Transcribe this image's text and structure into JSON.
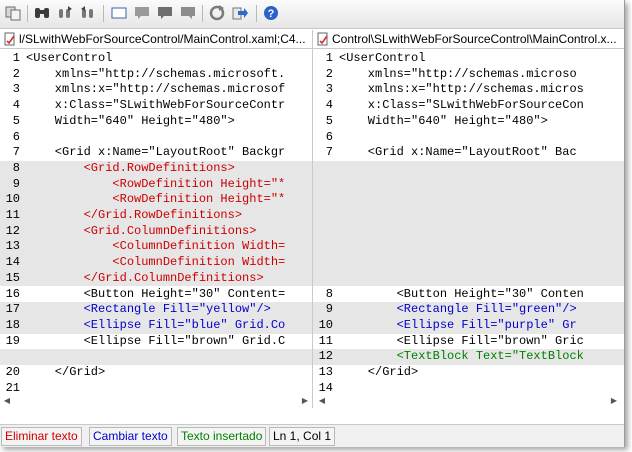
{
  "colors": {
    "deleted": "#cc0000",
    "changed": "#0000cc",
    "inserted": "#008000",
    "normal": "#000000"
  },
  "toolbar": {
    "icons": [
      "copy-icon",
      "binoculars-icon",
      "find-previous-icon",
      "find-next-icon",
      "rectangle-icon",
      "comment-icon",
      "comment-dark-icon",
      "comment-alt-icon",
      "refresh-icon",
      "export-arrow-icon",
      "help-icon"
    ]
  },
  "left": {
    "title": "l/SLwithWebForSourceControl/MainControl.xaml;C4...",
    "lines": [
      {
        "n": "1",
        "t": "<UserControl",
        "c": "normal",
        "g": false
      },
      {
        "n": "2",
        "t": "    xmlns=\"http://schemas.microsoft.",
        "c": "normal",
        "g": false
      },
      {
        "n": "3",
        "t": "    xmlns:x=\"http://schemas.microsof",
        "c": "normal",
        "g": false
      },
      {
        "n": "4",
        "t": "    x:Class=\"SLwithWebForSourceContr",
        "c": "normal",
        "g": false
      },
      {
        "n": "5",
        "t": "    Width=\"640\" Height=\"480\">",
        "c": "normal",
        "g": false
      },
      {
        "n": "6",
        "t": "",
        "c": "normal",
        "g": false
      },
      {
        "n": "7",
        "t": "    <Grid x:Name=\"LayoutRoot\" Backgr",
        "c": "normal",
        "g": false
      },
      {
        "n": "8",
        "t": "        <Grid.RowDefinitions>",
        "c": "deleted",
        "g": true
      },
      {
        "n": "9",
        "t": "            <RowDefinition Height=\"*",
        "c": "deleted",
        "g": true
      },
      {
        "n": "10",
        "t": "            <RowDefinition Height=\"*",
        "c": "deleted",
        "g": true
      },
      {
        "n": "11",
        "t": "        </Grid.RowDefinitions>",
        "c": "deleted",
        "g": true
      },
      {
        "n": "12",
        "t": "        <Grid.ColumnDefinitions>",
        "c": "deleted",
        "g": true
      },
      {
        "n": "13",
        "t": "            <ColumnDefinition Width=",
        "c": "deleted",
        "g": true
      },
      {
        "n": "14",
        "t": "            <ColumnDefinition Width=",
        "c": "deleted",
        "g": true
      },
      {
        "n": "15",
        "t": "        </Grid.ColumnDefinitions>",
        "c": "deleted",
        "g": true
      },
      {
        "n": "16",
        "t": "        <Button Height=\"30\" Content=",
        "c": "normal",
        "g": false
      },
      {
        "n": "17",
        "t": "        <Rectangle Fill=\"yellow\"/>",
        "c": "changed",
        "g": true
      },
      {
        "n": "18",
        "t": "        <Ellipse Fill=\"blue\" Grid.Co",
        "c": "changed",
        "g": true
      },
      {
        "n": "19",
        "t": "        <Ellipse Fill=\"brown\" Grid.C",
        "c": "normal",
        "g": false
      },
      {
        "n": "",
        "t": "",
        "c": "normal",
        "g": true
      },
      {
        "n": "20",
        "t": "    </Grid>",
        "c": "normal",
        "g": false
      },
      {
        "n": "21",
        "t": "",
        "c": "normal",
        "g": false
      }
    ]
  },
  "right": {
    "title": "Control\\SLwithWebForSourceControl\\MainControl.x...",
    "lines": [
      {
        "n": "1",
        "t": "<UserControl",
        "c": "normal",
        "g": false
      },
      {
        "n": "2",
        "t": "    xmlns=\"http://schemas.microso",
        "c": "normal",
        "g": false
      },
      {
        "n": "3",
        "t": "    xmlns:x=\"http://schemas.micros",
        "c": "normal",
        "g": false
      },
      {
        "n": "4",
        "t": "    x:Class=\"SLwithWebForSourceCon",
        "c": "normal",
        "g": false
      },
      {
        "n": "5",
        "t": "    Width=\"640\" Height=\"480\">",
        "c": "normal",
        "g": false
      },
      {
        "n": "6",
        "t": "",
        "c": "normal",
        "g": false
      },
      {
        "n": "7",
        "t": "    <Grid x:Name=\"LayoutRoot\" Bac",
        "c": "normal",
        "g": false
      },
      {
        "n": "",
        "t": "",
        "c": "normal",
        "g": true
      },
      {
        "n": "",
        "t": "",
        "c": "normal",
        "g": true
      },
      {
        "n": "",
        "t": "",
        "c": "normal",
        "g": true
      },
      {
        "n": "",
        "t": "",
        "c": "normal",
        "g": true
      },
      {
        "n": "",
        "t": "",
        "c": "normal",
        "g": true
      },
      {
        "n": "",
        "t": "",
        "c": "normal",
        "g": true
      },
      {
        "n": "",
        "t": "",
        "c": "normal",
        "g": true
      },
      {
        "n": "",
        "t": "",
        "c": "normal",
        "g": true
      },
      {
        "n": "8",
        "t": "        <Button Height=\"30\" Conten",
        "c": "normal",
        "g": false
      },
      {
        "n": "9",
        "t": "        <Rectangle Fill=\"green\"/>",
        "c": "changed",
        "g": true
      },
      {
        "n": "10",
        "t": "        <Ellipse Fill=\"purple\" Gr",
        "c": "changed",
        "g": true
      },
      {
        "n": "11",
        "t": "        <Ellipse Fill=\"brown\" Gric",
        "c": "normal",
        "g": false
      },
      {
        "n": "12",
        "t": "        <TextBlock Text=\"TextBlock",
        "c": "inserted",
        "g": true
      },
      {
        "n": "13",
        "t": "    </Grid>",
        "c": "normal",
        "g": false
      },
      {
        "n": "14",
        "t": "",
        "c": "normal",
        "g": false
      }
    ]
  },
  "status": {
    "deleted_label": "Eliminar texto",
    "changed_label": "Cambiar texto",
    "inserted_label": "Texto insertado",
    "position": "Ln 1, Col 1"
  }
}
